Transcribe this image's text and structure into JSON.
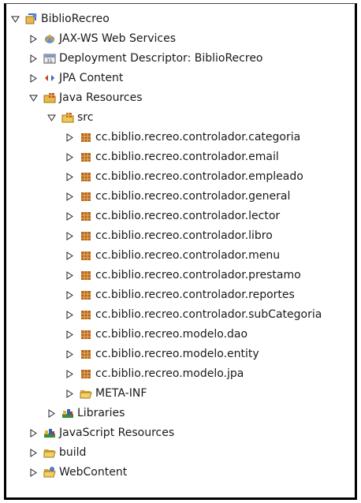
{
  "tree": [
    {
      "label": "BiblioRecreo",
      "icon": "project-icon",
      "expanded": true,
      "depth": 0
    },
    {
      "label": "JAX-WS Web Services",
      "icon": "web-services-icon",
      "expanded": false,
      "depth": 1
    },
    {
      "label": "Deployment Descriptor: BiblioRecreo",
      "icon": "deployment-descriptor-icon",
      "expanded": false,
      "depth": 1
    },
    {
      "label": "JPA Content",
      "icon": "jpa-icon",
      "expanded": false,
      "depth": 1
    },
    {
      "label": "Java Resources",
      "icon": "java-resources-icon",
      "expanded": true,
      "depth": 1
    },
    {
      "label": "src",
      "icon": "source-folder-icon",
      "expanded": true,
      "depth": 2
    },
    {
      "label": "cc.biblio.recreo.controlador.categoria",
      "icon": "package-icon",
      "expanded": false,
      "depth": 3
    },
    {
      "label": "cc.biblio.recreo.controlador.email",
      "icon": "package-icon",
      "expanded": false,
      "depth": 3
    },
    {
      "label": "cc.biblio.recreo.controlador.empleado",
      "icon": "package-icon",
      "expanded": false,
      "depth": 3
    },
    {
      "label": "cc.biblio.recreo.controlador.general",
      "icon": "package-icon",
      "expanded": false,
      "depth": 3
    },
    {
      "label": "cc.biblio.recreo.controlador.lector",
      "icon": "package-icon",
      "expanded": false,
      "depth": 3
    },
    {
      "label": "cc.biblio.recreo.controlador.libro",
      "icon": "package-icon",
      "expanded": false,
      "depth": 3
    },
    {
      "label": "cc.biblio.recreo.controlador.menu",
      "icon": "package-icon",
      "expanded": false,
      "depth": 3
    },
    {
      "label": "cc.biblio.recreo.controlador.prestamo",
      "icon": "package-icon",
      "expanded": false,
      "depth": 3
    },
    {
      "label": "cc.biblio.recreo.controlador.reportes",
      "icon": "package-icon",
      "expanded": false,
      "depth": 3
    },
    {
      "label": "cc.biblio.recreo.controlador.subCategoria",
      "icon": "package-icon",
      "expanded": false,
      "depth": 3
    },
    {
      "label": "cc.biblio.recreo.modelo.dao",
      "icon": "package-icon",
      "expanded": false,
      "depth": 3
    },
    {
      "label": "cc.biblio.recreo.modelo.entity",
      "icon": "package-icon",
      "expanded": false,
      "depth": 3
    },
    {
      "label": "cc.biblio.recreo.modelo.jpa",
      "icon": "package-icon",
      "expanded": false,
      "depth": 3
    },
    {
      "label": "META-INF",
      "icon": "folder-icon",
      "expanded": false,
      "depth": 3
    },
    {
      "label": "Libraries",
      "icon": "libraries-icon",
      "expanded": false,
      "depth": 2
    },
    {
      "label": "JavaScript Resources",
      "icon": "libraries-icon",
      "expanded": false,
      "depth": 1
    },
    {
      "label": "build",
      "icon": "folder-icon",
      "expanded": false,
      "depth": 1
    },
    {
      "label": "WebContent",
      "icon": "web-folder-icon",
      "expanded": false,
      "depth": 1
    }
  ]
}
